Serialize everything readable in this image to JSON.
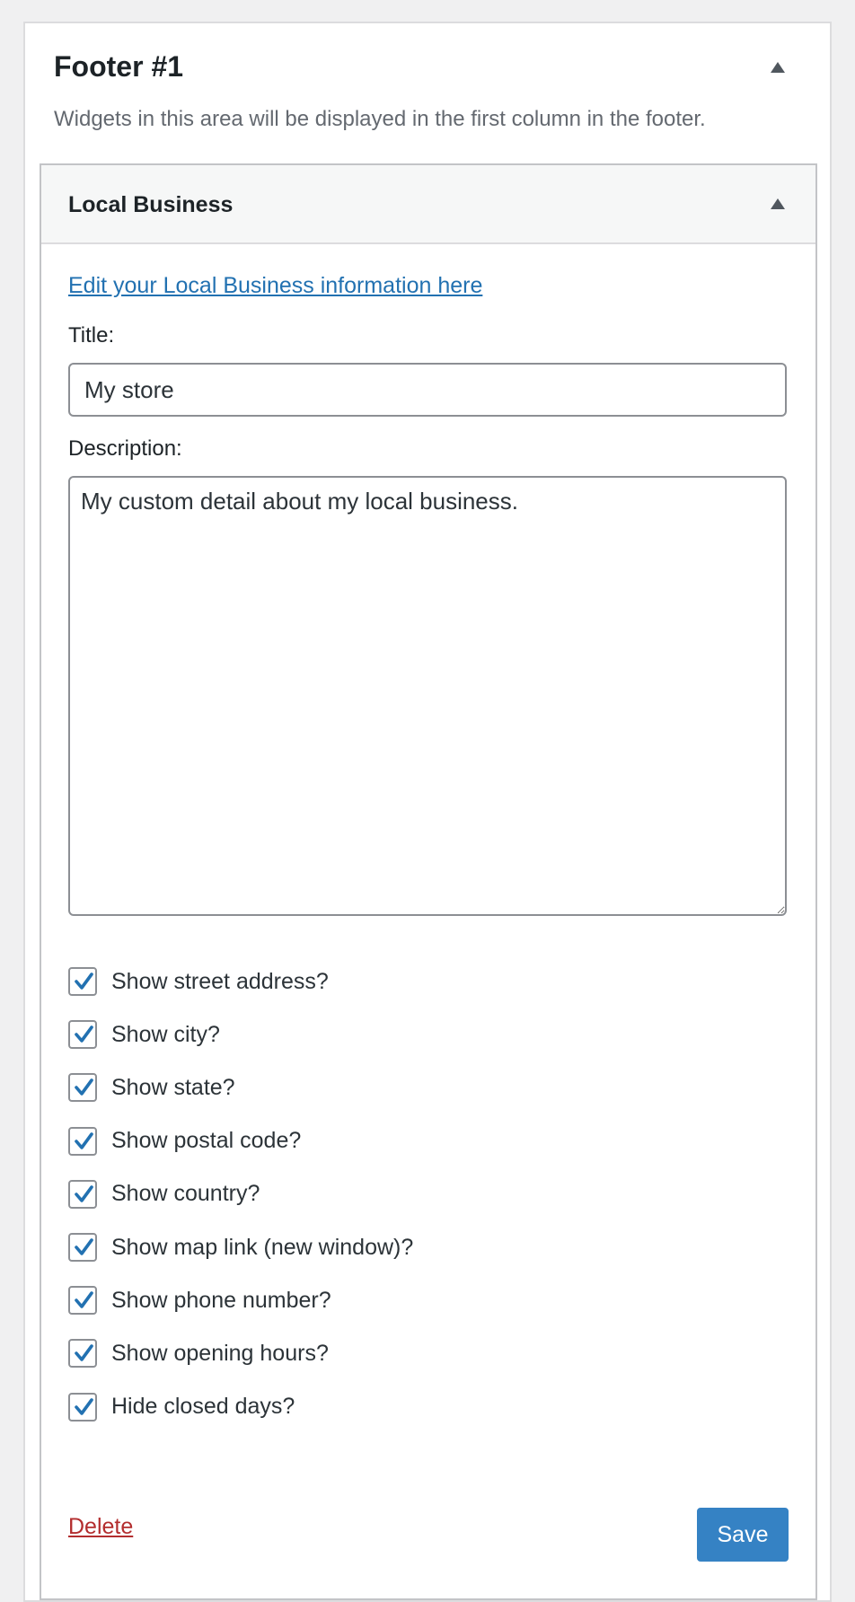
{
  "sidebar_area": {
    "title": "Footer #1",
    "description": "Widgets in this area will be displayed in the first column in the footer."
  },
  "widget": {
    "title": "Local Business",
    "edit_link": "Edit your Local Business information here",
    "title_label": "Title:",
    "title_value": "My store",
    "description_label": "Description:",
    "description_value": "My custom detail about my local business.",
    "checkboxes": [
      {
        "label": "Show street address?",
        "checked": true
      },
      {
        "label": "Show city?",
        "checked": true
      },
      {
        "label": "Show state?",
        "checked": true
      },
      {
        "label": "Show postal code?",
        "checked": true
      },
      {
        "label": "Show country?",
        "checked": true
      },
      {
        "label": "Show map link (new window)?",
        "checked": true
      },
      {
        "label": "Show phone number?",
        "checked": true
      },
      {
        "label": "Show opening hours?",
        "checked": true
      },
      {
        "label": "Hide closed days?",
        "checked": true
      }
    ],
    "delete_label": "Delete",
    "save_label": "Save"
  },
  "colors": {
    "link": "#2271b1",
    "checkmark": "#2271b1",
    "delete": "#b32d2e",
    "primary_button": "#3582c4"
  },
  "icons": {
    "area_toggle": "triangle-up-icon",
    "widget_toggle": "triangle-up-icon",
    "checkbox_mark": "checkmark-icon"
  }
}
